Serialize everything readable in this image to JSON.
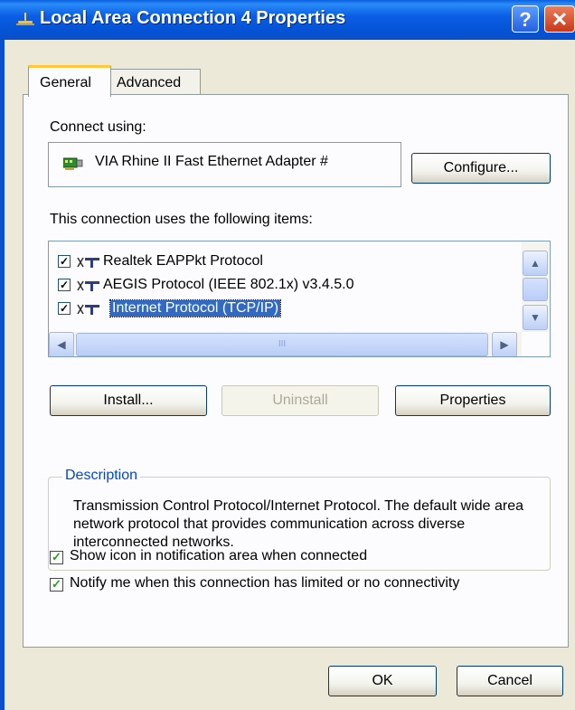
{
  "window": {
    "title": "Local Area Connection 4 Properties",
    "help_glyph": "?",
    "close_glyph": "✕"
  },
  "tabs": [
    {
      "label": "General",
      "active": true
    },
    {
      "label": "Advanced",
      "active": false
    }
  ],
  "general": {
    "connect_using_label": "Connect using:",
    "adapter_name": "VIA Rhine II Fast Ethernet Adapter #",
    "configure_button": "Configure...",
    "items_label": "This connection uses the following items:",
    "items": [
      {
        "label": "Realtek EAPPkt Protocol",
        "checked": true,
        "selected": false
      },
      {
        "label": "AEGIS Protocol (IEEE 802.1x) v3.4.5.0",
        "checked": true,
        "selected": false
      },
      {
        "label": "Internet Protocol (TCP/IP)",
        "checked": true,
        "selected": true
      }
    ],
    "install_button": "Install...",
    "uninstall_button": "Uninstall",
    "properties_button": "Properties",
    "description_title": "Description",
    "description_text": "Transmission Control Protocol/Internet Protocol. The default wide area network protocol that provides communication across diverse interconnected networks.",
    "show_icon_label": "Show icon in notification area when connected",
    "show_icon_checked": true,
    "notify_label": "Notify me when this connection has limited or no connectivity",
    "notify_checked": true
  },
  "footer": {
    "ok_button": "OK",
    "cancel_button": "Cancel"
  },
  "scrollbar_glyphs": {
    "up": "▲",
    "down": "▼",
    "left": "◀",
    "right": "▶",
    "grip": "III"
  },
  "colors": {
    "titlebar": "#0553d6",
    "selection": "#316ac5",
    "group_title": "#0046d5",
    "checkbox_check": "#21a121"
  }
}
